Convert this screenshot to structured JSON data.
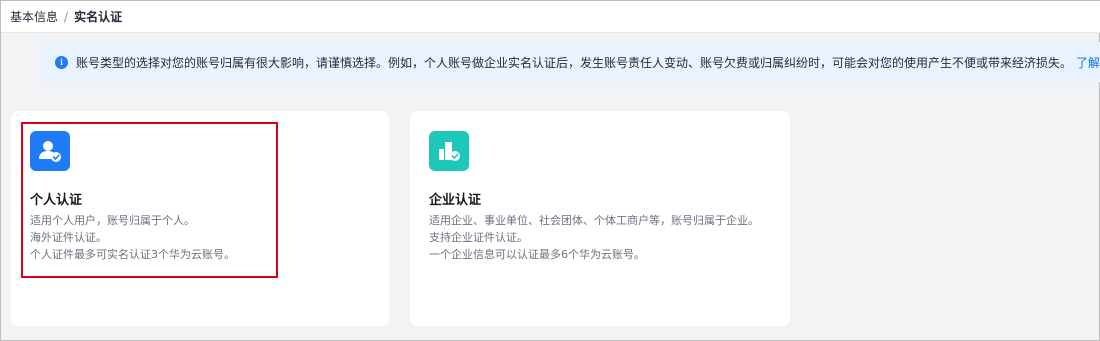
{
  "breadcrumb": {
    "parent": "基本信息",
    "separator": "/",
    "current": "实名认证"
  },
  "notice": {
    "text": "账号类型的选择对您的账号归属有很大影响，请谨慎选择。例如，个人账号做企业实名认证后，发生账号责任人变动、账号欠费或归属纠纷时，可能会对您的使用产生不便或带来经济损失。",
    "link": "了解详情"
  },
  "cards": {
    "personal": {
      "icon": "user-verified-icon",
      "title": "个人认证",
      "lines": [
        "适用个人用户，账号归属于个人。",
        "海外证件认证。",
        "个人证件最多可实名认证3个华为云账号。"
      ]
    },
    "enterprise": {
      "icon": "building-verified-icon",
      "title": "企业认证",
      "lines": [
        "适用企业、事业单位、社会团体、个体工商户等，账号归属于企业。",
        "支持企业证件认证。",
        "一个企业信息可以认证最多6个华为云账号。"
      ]
    }
  },
  "colors": {
    "personal_accent": "#1f7bf6",
    "enterprise_accent": "#1ec8b8",
    "link": "#0d6ef2",
    "highlight": "#d9001b"
  }
}
